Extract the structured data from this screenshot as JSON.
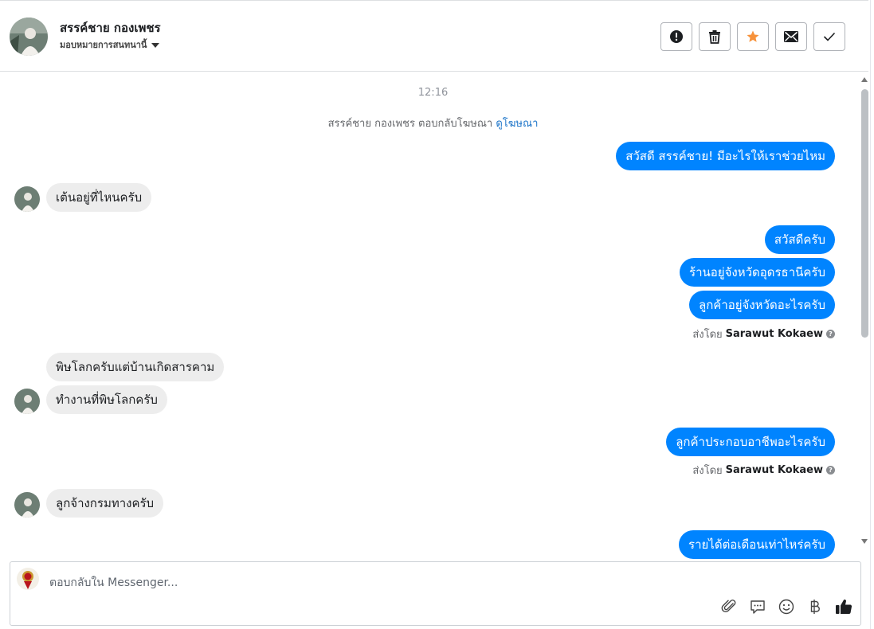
{
  "header": {
    "contact_name": "สรรค์ชาย กองเพชร",
    "assign_label": "มอบหมายการสนทนานี้",
    "actions": [
      {
        "name": "spam-icon"
      },
      {
        "name": "trash-icon"
      },
      {
        "name": "star-icon",
        "color": "#f7923b"
      },
      {
        "name": "envelope-icon"
      },
      {
        "name": "check-icon"
      }
    ]
  },
  "thread": {
    "timestamp": "12:16",
    "system_text": "สรรค์ชาย กองเพชร ตอบกลับโฆษณา",
    "system_link": "ดูโฆษณา",
    "messages": [
      {
        "from": "page",
        "text": "สวัสดี สรรค์ชาย! มีอะไรให้เราช่วยไหม"
      },
      {
        "from": "user",
        "text": "เต้นอยู่ที่ไหนครับ"
      },
      {
        "from": "page",
        "text": "สวัสดีครับ"
      },
      {
        "from": "page",
        "text": "ร้านอยู่จังหวัดอุดรธานีครับ"
      },
      {
        "from": "page",
        "text": "ลูกค้าอยู่จังหวัดอะไรครับ"
      },
      {
        "from": "user",
        "text": "พิษโลกครับแต่บ้านเกิดสารคาม"
      },
      {
        "from": "user",
        "text": "ทำงานที่พิษโลกครับ"
      },
      {
        "from": "page",
        "text": "ลูกค้าประกอบอาชีพอะไรครับ"
      },
      {
        "from": "user",
        "text": "ลูกจ้างกรมทางครับ"
      },
      {
        "from": "page",
        "text": "รายได้ต่อเดือนเท่าไหร่ครับ"
      }
    ],
    "sent_by_prefix": "ส่งโดย",
    "sent_by_name": "Sarawut Kokaew"
  },
  "composer": {
    "placeholder": "ตอบกลับใน Messenger...",
    "tools": [
      "paperclip-icon",
      "saved-reply-icon",
      "emoji-icon",
      "baht-icon",
      "thumbs-up-icon"
    ]
  },
  "colors": {
    "outgoing_bubble": "#0084ff",
    "incoming_bubble": "#ededed",
    "link": "#1a73c8"
  }
}
